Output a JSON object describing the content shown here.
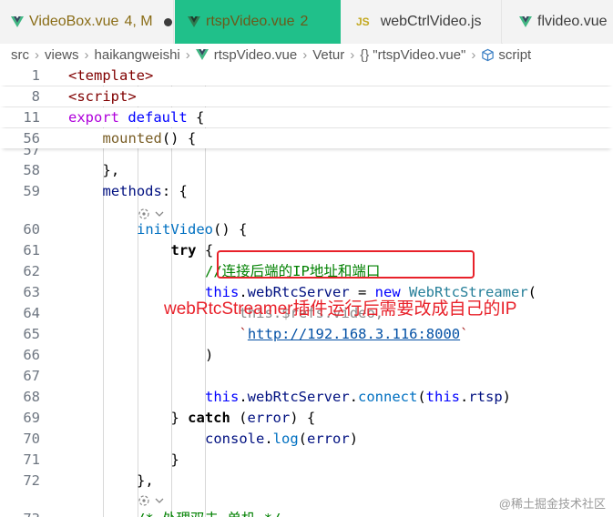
{
  "tabs": [
    {
      "name": "VideoBox.vue",
      "badge": "4, M",
      "state": "modified-unsaved"
    },
    {
      "name": "rtspVideo.vue",
      "badge": "2",
      "state": "active"
    },
    {
      "name": "webCtrlVideo.js",
      "icon_text": "JS",
      "state": "normal"
    },
    {
      "name": "flvideo.vue",
      "state": "normal"
    }
  ],
  "breadcrumb": {
    "parts": [
      "src",
      "views",
      "haikangweishi",
      "rtspVideo.vue",
      "Vetur"
    ],
    "braces": "{}",
    "component": "\"rtspVideo.vue\"",
    "last": "script"
  },
  "sticky": [
    {
      "ln": "1",
      "parts": [
        [
          "tag",
          "<template>"
        ]
      ]
    },
    {
      "ln": "8",
      "parts": [
        [
          "tag",
          "<script>"
        ]
      ]
    },
    {
      "ln": "11",
      "parts": [
        [
          "kw2",
          "export"
        ],
        [
          "pun",
          " "
        ],
        [
          "kw",
          "default"
        ],
        [
          "pun",
          " {"
        ]
      ]
    },
    {
      "ln": "56",
      "parts": [
        [
          "fn",
          "mounted"
        ],
        [
          "pun",
          "() {"
        ]
      ]
    }
  ],
  "partial_line": {
    "parts": [
      [
        "faded",
        "this.initVideo()"
      ]
    ]
  },
  "lines": [
    {
      "ln": "58",
      "parts": [
        [
          "pun",
          "},"
        ]
      ]
    },
    {
      "ln": "59",
      "parts": [
        [
          "var",
          "methods"
        ],
        [
          "pun",
          ": {"
        ]
      ]
    },
    {
      "ln": "60",
      "parts": [
        [
          "m",
          "initVideo"
        ],
        [
          "pun",
          "() {"
        ]
      ]
    },
    {
      "ln": "61",
      "parts": [
        [
          "ctl",
          "try"
        ],
        [
          "pun",
          " {"
        ]
      ]
    },
    {
      "ln": "62",
      "parts": [
        [
          "cm",
          "//连接后端的IP地址和端口"
        ]
      ]
    },
    {
      "ln": "63",
      "parts": [
        [
          "this",
          "this"
        ],
        [
          "pun",
          "."
        ],
        [
          "var",
          "webRtcServer"
        ],
        [
          "pun",
          " = "
        ],
        [
          "kw",
          "new"
        ],
        [
          "pun",
          " "
        ],
        [
          "cls",
          "WebRtcStreamer"
        ],
        [
          "pun",
          "("
        ]
      ]
    },
    {
      "ln": "64",
      "parts": [
        [
          "faded",
          "this.$refs.video,"
        ]
      ]
    },
    {
      "ln": "65",
      "parts": [
        [
          "str",
          "`"
        ],
        [
          "url",
          "http://192.168.3.116:8000"
        ],
        [
          "str",
          "`"
        ]
      ]
    },
    {
      "ln": "66",
      "parts": [
        [
          "pun",
          ")"
        ]
      ]
    },
    {
      "ln": "67",
      "parts": []
    },
    {
      "ln": "68",
      "parts": [
        [
          "this",
          "this"
        ],
        [
          "pun",
          "."
        ],
        [
          "var",
          "webRtcServer"
        ],
        [
          "pun",
          "."
        ],
        [
          "m",
          "connect"
        ],
        [
          "pun",
          "("
        ],
        [
          "this",
          "this"
        ],
        [
          "pun",
          "."
        ],
        [
          "var",
          "rtsp"
        ],
        [
          "pun",
          ")"
        ]
      ]
    },
    {
      "ln": "69",
      "parts": [
        [
          "pun",
          "} "
        ],
        [
          "ctl",
          "catch"
        ],
        [
          "pun",
          " ("
        ],
        [
          "var",
          "error"
        ],
        [
          "pun",
          ") {"
        ]
      ]
    },
    {
      "ln": "70",
      "parts": [
        [
          "var",
          "console"
        ],
        [
          "pun",
          "."
        ],
        [
          "m",
          "log"
        ],
        [
          "pun",
          "("
        ],
        [
          "var",
          "error"
        ],
        [
          "pun",
          ")"
        ]
      ]
    },
    {
      "ln": "71",
      "parts": [
        [
          "pun",
          "}"
        ]
      ]
    },
    {
      "ln": "72",
      "parts": [
        [
          "pun",
          "},"
        ]
      ]
    },
    {
      "ln": "73",
      "parts": [
        [
          "cm",
          "/* 处理双击 单机 */"
        ]
      ]
    }
  ],
  "partial_top": {
    "ln": "57"
  },
  "annotation": "webRtcStreamer插件运行后需要改成自己的IP",
  "watermark": "@稀土掘金技术社区",
  "colors": {
    "accent_tab": "#20c08a",
    "annotation_red": "#e8212a"
  }
}
